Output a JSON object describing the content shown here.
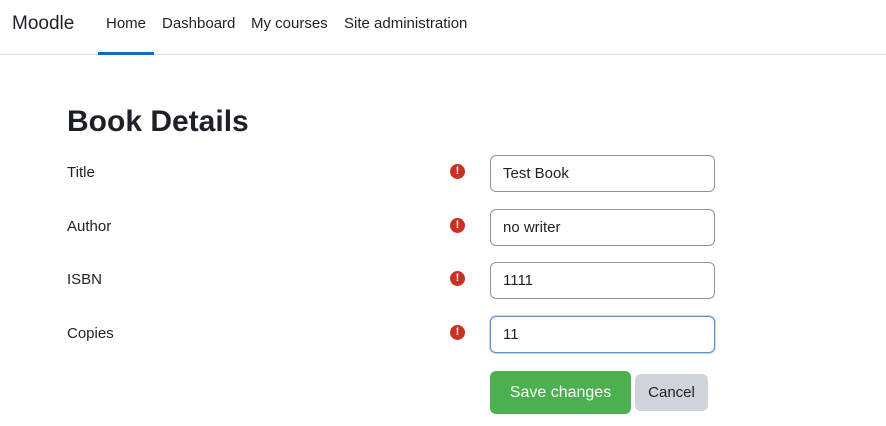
{
  "navbar": {
    "brand": "Moodle",
    "links": [
      {
        "label": "Home",
        "active": true
      },
      {
        "label": "Dashboard",
        "active": false
      },
      {
        "label": "My courses",
        "active": false
      },
      {
        "label": "Site administration",
        "active": false
      }
    ]
  },
  "page": {
    "title": "Book Details"
  },
  "form": {
    "required_icon": "exclamation-icon",
    "fields": [
      {
        "label": "Title",
        "value": "Test Book"
      },
      {
        "label": "Author",
        "value": "no writer"
      },
      {
        "label": "ISBN",
        "value": "1111"
      },
      {
        "label": "Copies",
        "value": "11"
      }
    ],
    "save_label": "Save changes",
    "cancel_label": "Cancel"
  },
  "colors": {
    "accent": "#0f6cbf",
    "required": "#ca3120",
    "save": "#4caf50",
    "cancel": "#ced4da"
  }
}
